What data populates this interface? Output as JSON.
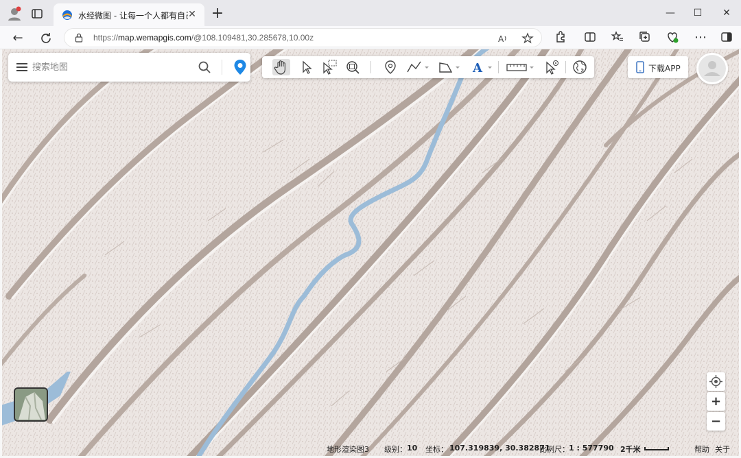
{
  "browser": {
    "tab_title": "水经微图 - 让每一个人都有自己的",
    "url_proto": "https://",
    "url_host": "map.wemapgis.com",
    "url_path": "/@108.109481,30.285678,10.00z"
  },
  "map": {
    "search_placeholder": "搜索地图",
    "app_button_label": "下载APP",
    "zoom_in_label": "+",
    "zoom_out_label": "−",
    "tools": [
      "pan-icon",
      "select-icon",
      "box-select-icon",
      "zoom-box-icon",
      "marker-icon",
      "polyline-icon",
      "polygon-icon",
      "text-icon",
      "ruler-icon",
      "pointer-info-icon",
      "globe-icon"
    ]
  },
  "status": {
    "layer_name": "地形渲染图3",
    "level_label": "级别：",
    "level_value": "10",
    "coord_label": "坐标：",
    "coord_value": "107.319839, 30.382871",
    "scale_label": "比例尺：",
    "scale_value": "1 : 577790",
    "scale_bar_label": "2千米",
    "help_link": "帮助",
    "about_link": "关于"
  },
  "colors": {
    "map_bg": "#ece6e3",
    "river": "#9cbcd8",
    "ridge_dark": "#b0a29a",
    "accent_blue": "#1e88e5"
  }
}
